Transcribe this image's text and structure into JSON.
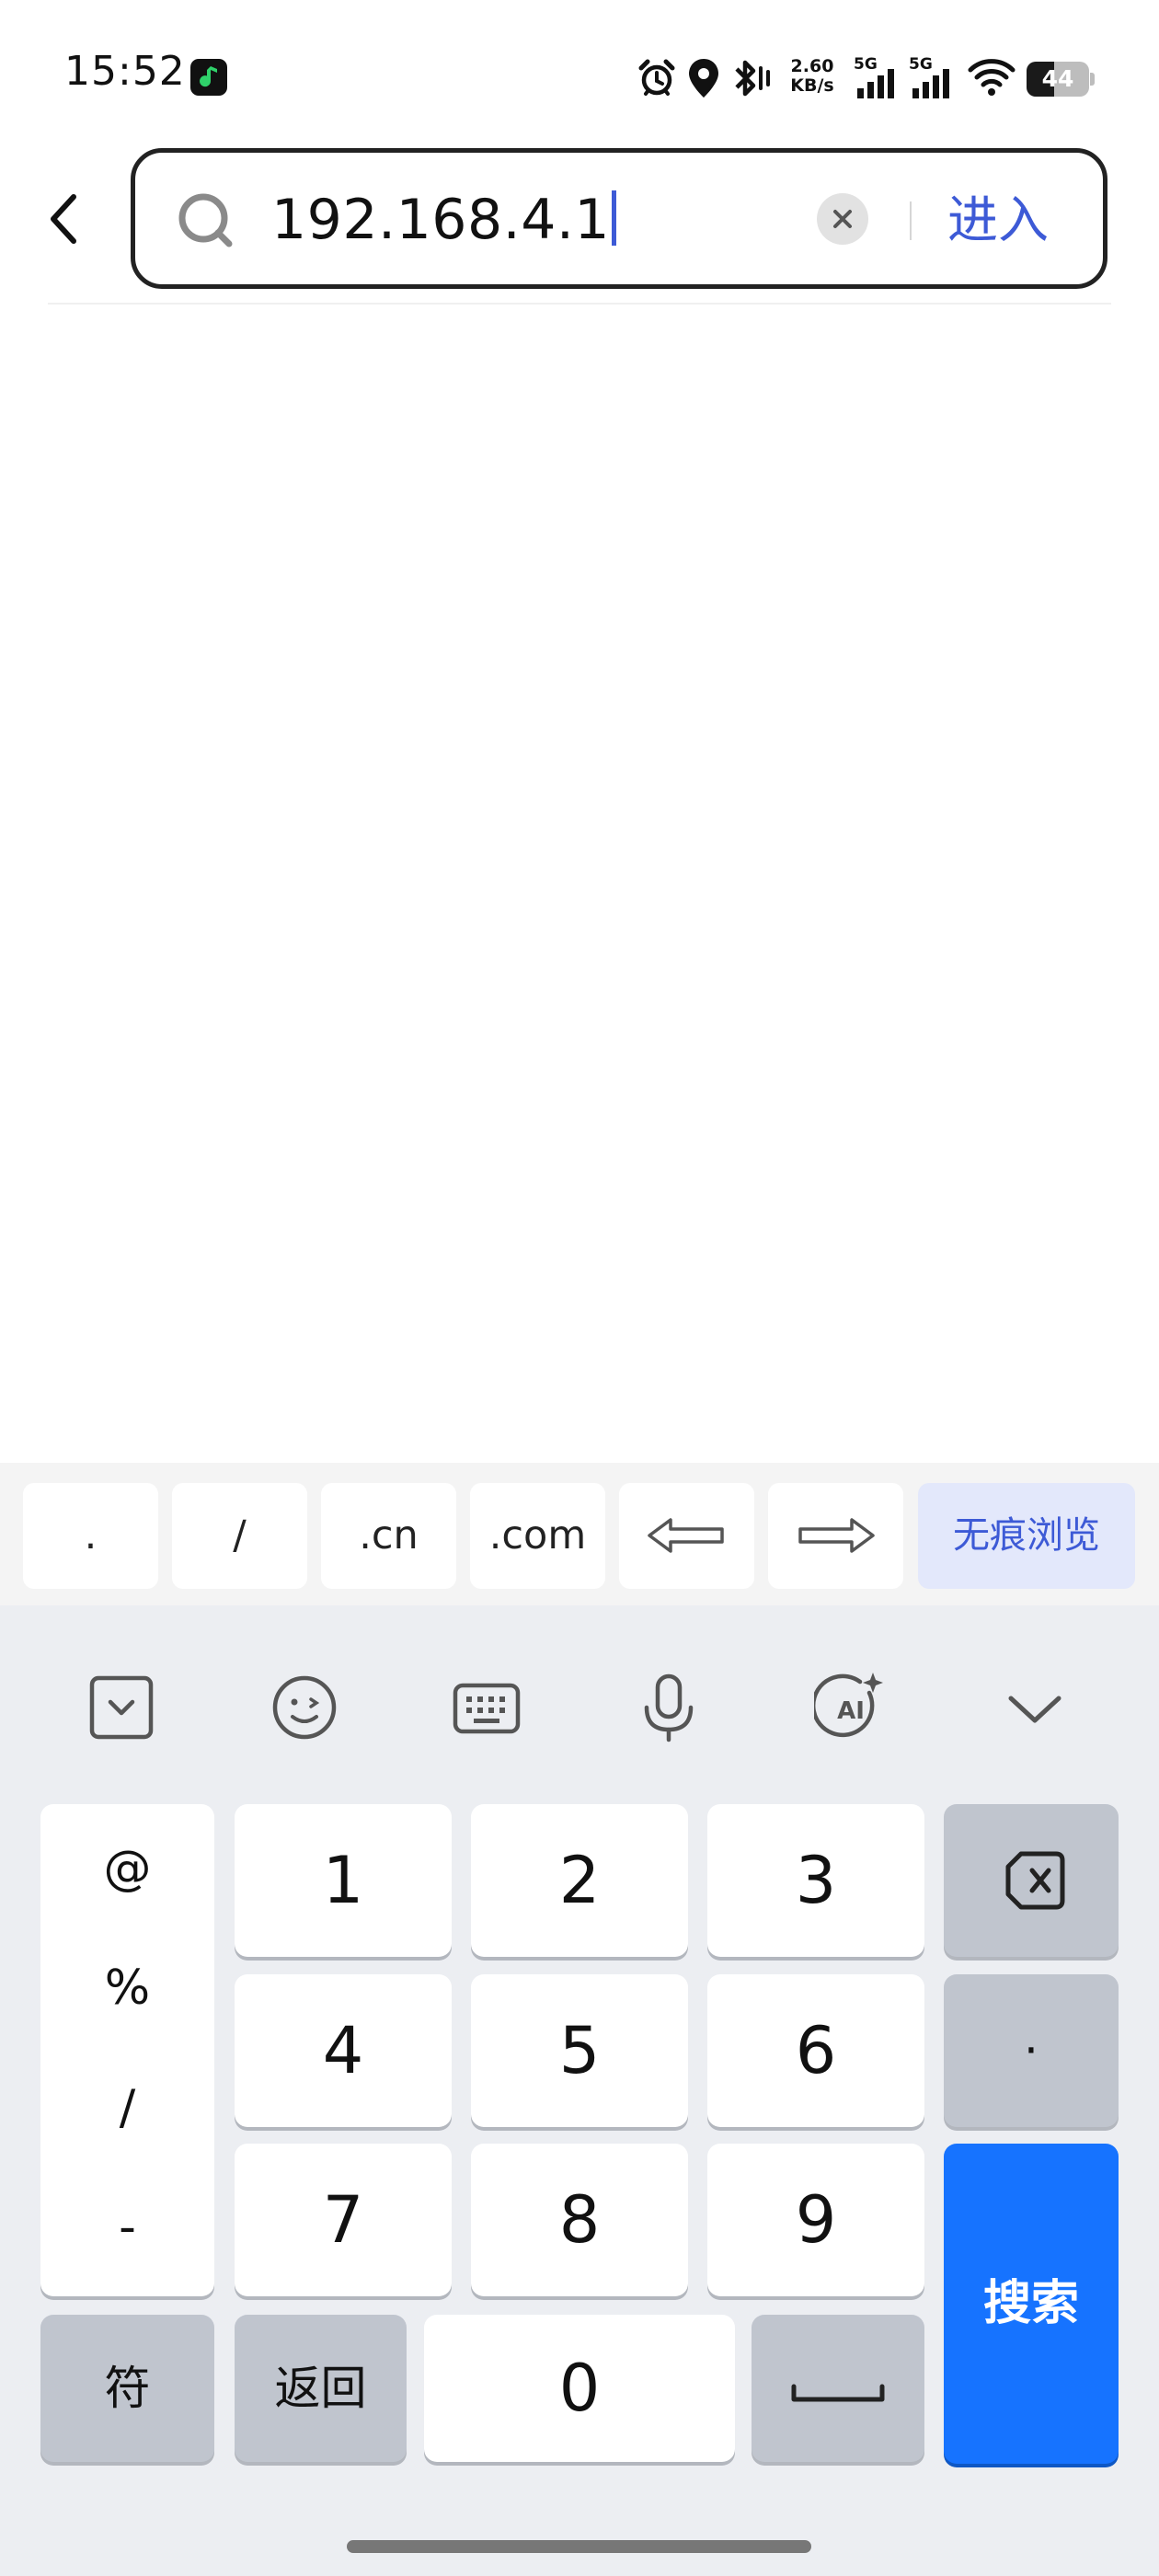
{
  "status_bar": {
    "time": "15:52",
    "net_speed_value": "2.60",
    "net_speed_unit": "KB/s",
    "sim1": "5G",
    "sim2": "5G",
    "battery_level": 44,
    "battery_text": "44"
  },
  "search": {
    "input_value": "192.168.4.1",
    "enter_label": "进入"
  },
  "quick_keys": [
    ".",
    "/",
    ".cn",
    ".com"
  ],
  "quick_incognito": "无痕浏览",
  "keyboard": {
    "toolbar_icons": [
      "collapse-box-icon",
      "emoji-icon",
      "keyboard-switch-icon",
      "microphone-icon",
      "ai-icon",
      "hide-keyboard-icon"
    ],
    "symbols": [
      "@",
      "%",
      "/",
      "-"
    ],
    "digits": [
      "1",
      "2",
      "3",
      "4",
      "5",
      "6",
      "7",
      "8",
      "9",
      "0"
    ],
    "dot": "·",
    "symbols_key": "符",
    "back_key": "返回",
    "search_key": "搜索"
  },
  "colors": {
    "accent": "#3d5ad6",
    "search_key": "#1673ff",
    "keyboard_bg": "#eceef2",
    "function_key": "#c0c5ce"
  }
}
